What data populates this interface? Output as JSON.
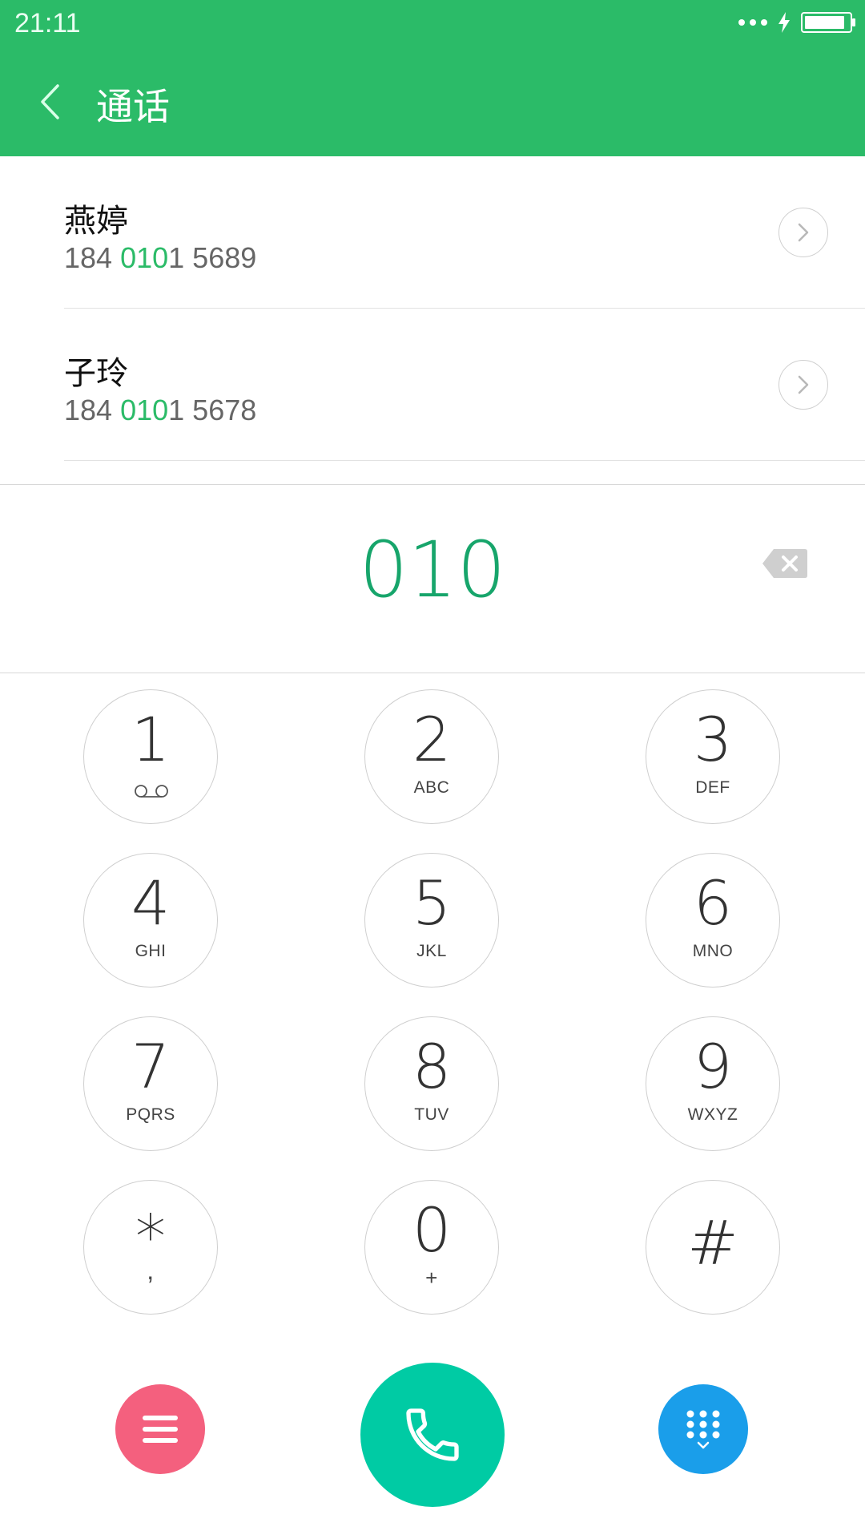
{
  "status_bar": {
    "time": "21:11",
    "battery_level": 0.9
  },
  "header": {
    "title": "通话",
    "background": "#2bbb68"
  },
  "contacts": [
    {
      "name": "燕婷",
      "number_prefix": "184 ",
      "number_match": "010",
      "number_suffix": "1 5689"
    },
    {
      "name": "子玲",
      "number_prefix": "184 ",
      "number_match": "010",
      "number_suffix": "1 5678"
    }
  ],
  "dialer": {
    "number": "010",
    "accent": "#17a56b"
  },
  "keypad": {
    "keys": [
      {
        "digit": "1",
        "letters": ""
      },
      {
        "digit": "2",
        "letters": "ABC"
      },
      {
        "digit": "3",
        "letters": "DEF"
      },
      {
        "digit": "4",
        "letters": "GHI"
      },
      {
        "digit": "5",
        "letters": "JKL"
      },
      {
        "digit": "6",
        "letters": "MNO"
      },
      {
        "digit": "7",
        "letters": "PQRS"
      },
      {
        "digit": "8",
        "letters": "TUV"
      },
      {
        "digit": "9",
        "letters": "WXYZ"
      },
      {
        "digit": "*",
        "letters": ","
      },
      {
        "digit": "0",
        "letters": "+"
      },
      {
        "digit": "#",
        "letters": ""
      }
    ]
  },
  "actions": {
    "menu_icon": "hamburger-icon",
    "call_icon": "phone-icon",
    "keypad_icon": "dialpad-icon",
    "menu_color": "#f4607e",
    "call_color": "#00cba4",
    "keypad_color": "#1a9eea"
  }
}
